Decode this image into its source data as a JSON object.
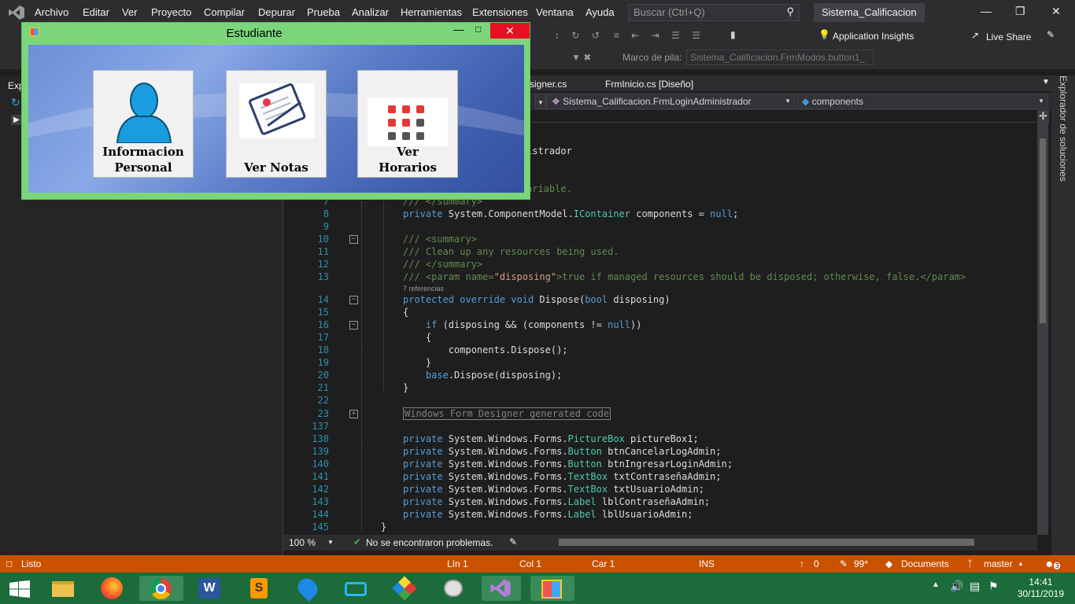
{
  "menubar": {
    "items": [
      "Archivo",
      "Editar",
      "Ver",
      "Proyecto",
      "Compilar",
      "Depurar",
      "Prueba",
      "Analizar",
      "Herramientas",
      "Extensiones",
      "Ventana",
      "Ayuda"
    ],
    "search_placeholder": "Buscar (Ctrl+Q)",
    "solution_title": "Sistema_Calificacion"
  },
  "toolbar": {
    "app_insights": "Application Insights",
    "live_share": "Live Share",
    "stack_frame_label": "Marco de pila:",
    "stack_frame_value": "Sistema_Calificacion.FrmModos.button1_"
  },
  "tabs": {
    "tab1": "signer.cs",
    "tab2": "FrmInicio.cs [Diseño]"
  },
  "navbar": {
    "class_dropdown": "Sistema_Calificacion.FrmLoginAdministrador",
    "member_dropdown": "components"
  },
  "left_panel": {
    "title_fragment": "Exp"
  },
  "right_strip": {
    "label": "Explorador de soluciones"
  },
  "editor": {
    "partial_line_1": "istrador",
    "partial_line_2": "ariable.",
    "lines": [
      {
        "n": "7",
        "text": "/// </summary>"
      },
      {
        "n": "8",
        "text": "private System.ComponentModel.IContainer components = null;"
      },
      {
        "n": "9",
        "text": ""
      },
      {
        "n": "10",
        "text": "/// <summary>"
      },
      {
        "n": "11",
        "text": "/// Clean up any resources being used."
      },
      {
        "n": "12",
        "text": "/// </summary>"
      },
      {
        "n": "13",
        "text": "/// <param name=\"disposing\">true if managed resources should be disposed; otherwise, false.</param>"
      },
      {
        "n": "14",
        "text": "protected override void Dispose(bool disposing)"
      },
      {
        "n": "15",
        "text": "{"
      },
      {
        "n": "16",
        "text": "    if (disposing && (components != null))"
      },
      {
        "n": "17",
        "text": "    {"
      },
      {
        "n": "18",
        "text": "        components.Dispose();"
      },
      {
        "n": "19",
        "text": "    }"
      },
      {
        "n": "20",
        "text": "    base.Dispose(disposing);"
      },
      {
        "n": "21",
        "text": "}"
      },
      {
        "n": "22",
        "text": ""
      },
      {
        "n": "23",
        "text": "Windows Form Designer generated code"
      },
      {
        "n": "137",
        "text": ""
      },
      {
        "n": "138",
        "text": "private System.Windows.Forms.PictureBox pictureBox1;"
      },
      {
        "n": "139",
        "text": "private System.Windows.Forms.Button btnCancelarLogAdmin;"
      },
      {
        "n": "140",
        "text": "private System.Windows.Forms.Button btnIngresarLoginAdmin;"
      },
      {
        "n": "141",
        "text": "private System.Windows.Forms.TextBox txtContraseñaAdmin;"
      },
      {
        "n": "142",
        "text": "private System.Windows.Forms.TextBox txtUsuarioAdmin;"
      },
      {
        "n": "143",
        "text": "private System.Windows.Forms.Label lblContraseñaAdmin;"
      },
      {
        "n": "144",
        "text": "private System.Windows.Forms.Label lblUsuarioAdmin;"
      },
      {
        "n": "145",
        "text": "}"
      }
    ],
    "references": "7 referencias",
    "zoom": "100 %",
    "problems": "No se encontraron problemas."
  },
  "statusbar": {
    "ready": "Listo",
    "line": "Lín 1",
    "col": "Col 1",
    "car": "Car 1",
    "ins": "INS",
    "up": "0",
    "pencil": "99*",
    "documents": "Documents",
    "branch": "master",
    "notifications": "3"
  },
  "taskbar": {
    "time": "14:41",
    "date": "30/11/2019"
  },
  "form": {
    "title": "Estudiante",
    "buttons": [
      {
        "line1": "Informacion",
        "line2": "Personal"
      },
      {
        "line1": "Ver Notas",
        "line2": ""
      },
      {
        "line1": "Ver",
        "line2": "Horarios"
      }
    ]
  },
  "colors": {
    "accent_status": "#ca5100",
    "form_border": "#7bd67b",
    "taskbar": "#1b6b3b"
  }
}
